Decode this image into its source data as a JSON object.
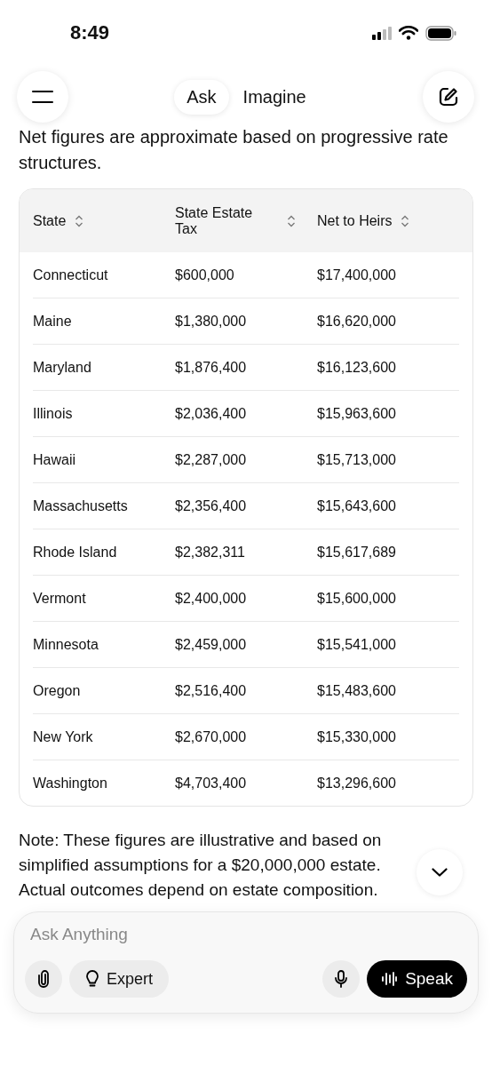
{
  "status_bar": {
    "time": "8:49"
  },
  "nav": {
    "tabs": [
      {
        "label": "Ask",
        "selected": true
      },
      {
        "label": "Imagine",
        "selected": false
      }
    ]
  },
  "intro": "Net figures are approximate based on progressive rate structures.",
  "table": {
    "columns": [
      "State",
      "State Estate Tax",
      "Net to Heirs"
    ],
    "rows": [
      [
        "Connecticut",
        "$600,000",
        "$17,400,000"
      ],
      [
        "Maine",
        "$1,380,000",
        "$16,620,000"
      ],
      [
        "Maryland",
        "$1,876,400",
        "$16,123,600"
      ],
      [
        "Illinois",
        "$2,036,400",
        "$15,963,600"
      ],
      [
        "Hawaii",
        "$2,287,000",
        "$15,713,000"
      ],
      [
        "Massachusetts",
        "$2,356,400",
        "$15,643,600"
      ],
      [
        "Rhode Island",
        "$2,382,311",
        "$15,617,689"
      ],
      [
        "Vermont",
        "$2,400,000",
        "$15,600,000"
      ],
      [
        "Minnesota",
        "$2,459,000",
        "$15,541,000"
      ],
      [
        "Oregon",
        "$2,516,400",
        "$15,483,600"
      ],
      [
        "New York",
        "$2,670,000",
        "$15,330,000"
      ],
      [
        "Washington",
        "$4,703,400",
        "$13,296,600"
      ]
    ]
  },
  "note": "Note: These figures are illustrative and based on simplified assumptions for a $20,000,000 estate. Actual outcomes depend on estate composition.",
  "composer": {
    "placeholder": "Ask Anything",
    "expert_label": "Expert",
    "speak_label": "Speak"
  }
}
